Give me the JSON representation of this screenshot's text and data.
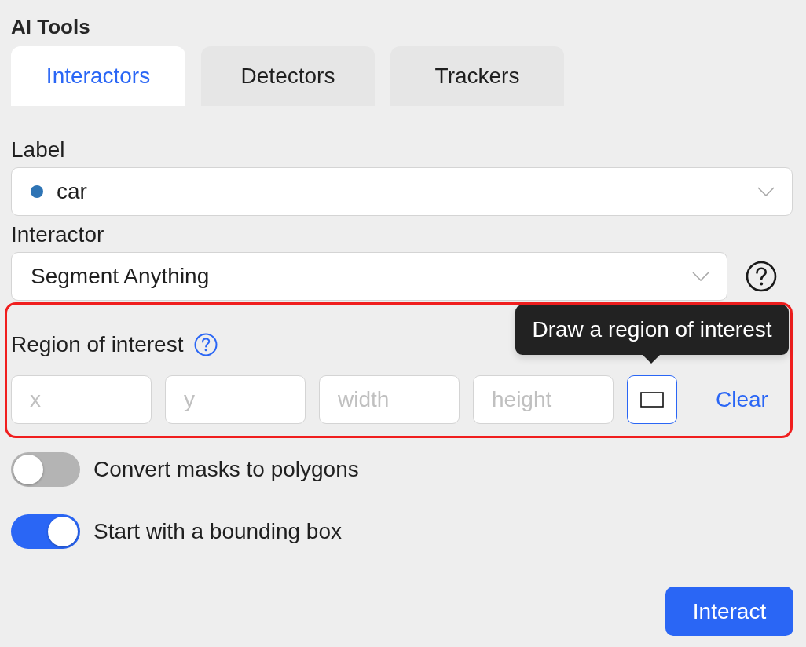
{
  "panel": {
    "title": "AI Tools"
  },
  "tabs": [
    {
      "label": "Interactors",
      "selected": true
    },
    {
      "label": "Detectors",
      "selected": false
    },
    {
      "label": "Trackers",
      "selected": false
    }
  ],
  "label_field": {
    "label": "Label",
    "value": "car",
    "color": "#2e74b5"
  },
  "interactor_field": {
    "label": "Interactor",
    "value": "Segment Anything"
  },
  "region_of_interest": {
    "highlighted": true,
    "label": "Region of interest",
    "inputs": [
      {
        "placeholder": "x"
      },
      {
        "placeholder": "y"
      },
      {
        "placeholder": "width"
      },
      {
        "placeholder": "height"
      }
    ],
    "draw_button": {
      "active": true
    },
    "tooltip": "Draw a region of interest",
    "clear": "Clear"
  },
  "toggles": [
    {
      "label": "Convert masks to polygons",
      "on": false
    },
    {
      "label": "Start with a bounding box",
      "on": true
    }
  ],
  "buttons": [
    {
      "label": "Interact"
    }
  ]
}
